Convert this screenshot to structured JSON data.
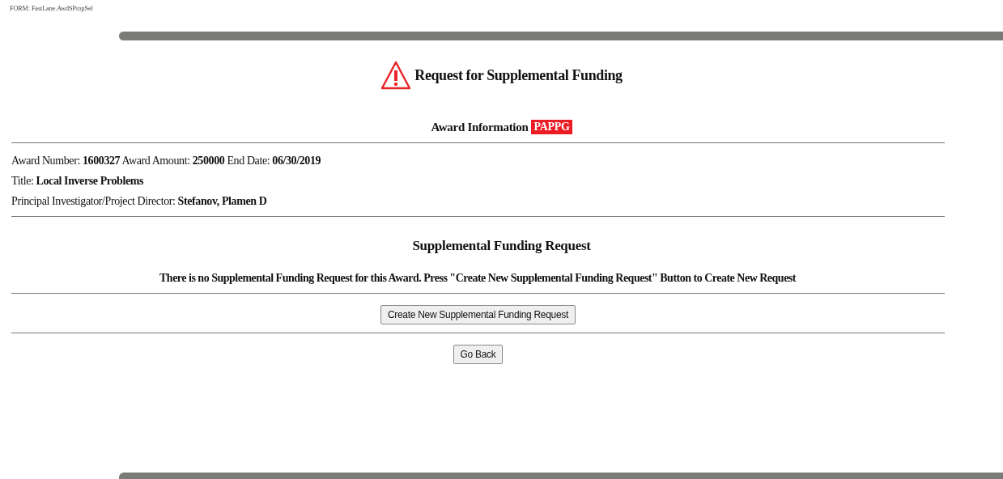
{
  "form_id": "FORM: FastLane.AwdSPropSel",
  "title": "Request for Supplemental Funding",
  "award_section": {
    "heading": "Award Information",
    "badge": "PAPPG"
  },
  "award_lines": [
    "Award Number: **1600327** Award Amount: **250000** End Date: **06/30/2019**",
    "Title: **Local Inverse Problems**",
    "Principal Investigator/Project Director: **Stefanov, Plamen D**"
  ],
  "request_section": {
    "heading": "Supplemental Funding Request",
    "message": "There is no Supplemental Funding Request for this Award. Press \"Create New Supplemental Funding Request\" Button to Create New Request"
  },
  "buttons": [
    "Create New Supplemental Funding Request",
    "Go Back"
  ]
}
